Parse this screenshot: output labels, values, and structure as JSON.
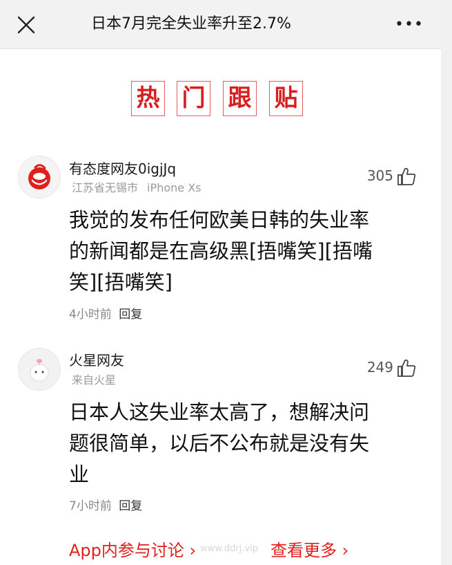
{
  "header": {
    "title": "日本7月完全失业率升至2.7%",
    "more_label": "•••"
  },
  "section": {
    "chars": [
      "热",
      "门",
      "跟",
      "贴"
    ]
  },
  "comments": [
    {
      "user": "有态度网友0igjJq",
      "location": "江苏省无锡市",
      "device": "iPhone Xs",
      "likes": "305",
      "text_lines": [
        "我觉的发布任何欧美日韩的失业率",
        "的新闻都是在高级黑[捂嘴笑][捂嘴",
        "笑][捂嘴笑]"
      ],
      "time": "4小时前",
      "reply_label": "回复"
    },
    {
      "user": "火星网友",
      "location": "来自火星",
      "device": "",
      "likes": "249",
      "text_lines": [
        "日本人这失业率太高了，想解决问",
        "题很简单，以后不公布就是没有失",
        "业"
      ],
      "time": "7小时前",
      "reply_label": "回复"
    }
  ],
  "footer": {
    "app_link": "App内参与讨论 ›",
    "more_link": "查看更多 ›",
    "watermark": "www.ddrj.vip"
  },
  "colors": {
    "accent_red": "#e0201d",
    "topbar_bg": "#f2f2f2"
  }
}
